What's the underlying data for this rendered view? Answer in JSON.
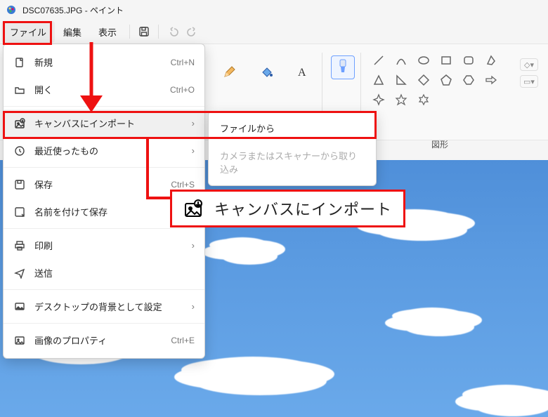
{
  "title": "DSC07635.JPG - ペイント",
  "menubar": {
    "file": "ファイル",
    "edit": "編集",
    "view": "表示"
  },
  "file_menu": {
    "new_": "新規",
    "open": "開く",
    "import_canvas": "キャンバスにインポート",
    "recent": "最近使ったもの",
    "save": "保存",
    "save_as": "名前を付けて保存",
    "print": "印刷",
    "send": "送信",
    "set_wallpaper": "デスクトップの背景として設定",
    "properties": "画像のプロパティ",
    "sc_new": "Ctrl+N",
    "sc_open": "Ctrl+O",
    "sc_save": "Ctrl+S",
    "sc_props": "Ctrl+E"
  },
  "import_submenu": {
    "from_file": "ファイルから",
    "from_scanner": "カメラまたはスキャナーから取り込み"
  },
  "ribbon": {
    "shapes_label": "図形"
  },
  "callout": {
    "text": "キャンバスにインポート"
  }
}
